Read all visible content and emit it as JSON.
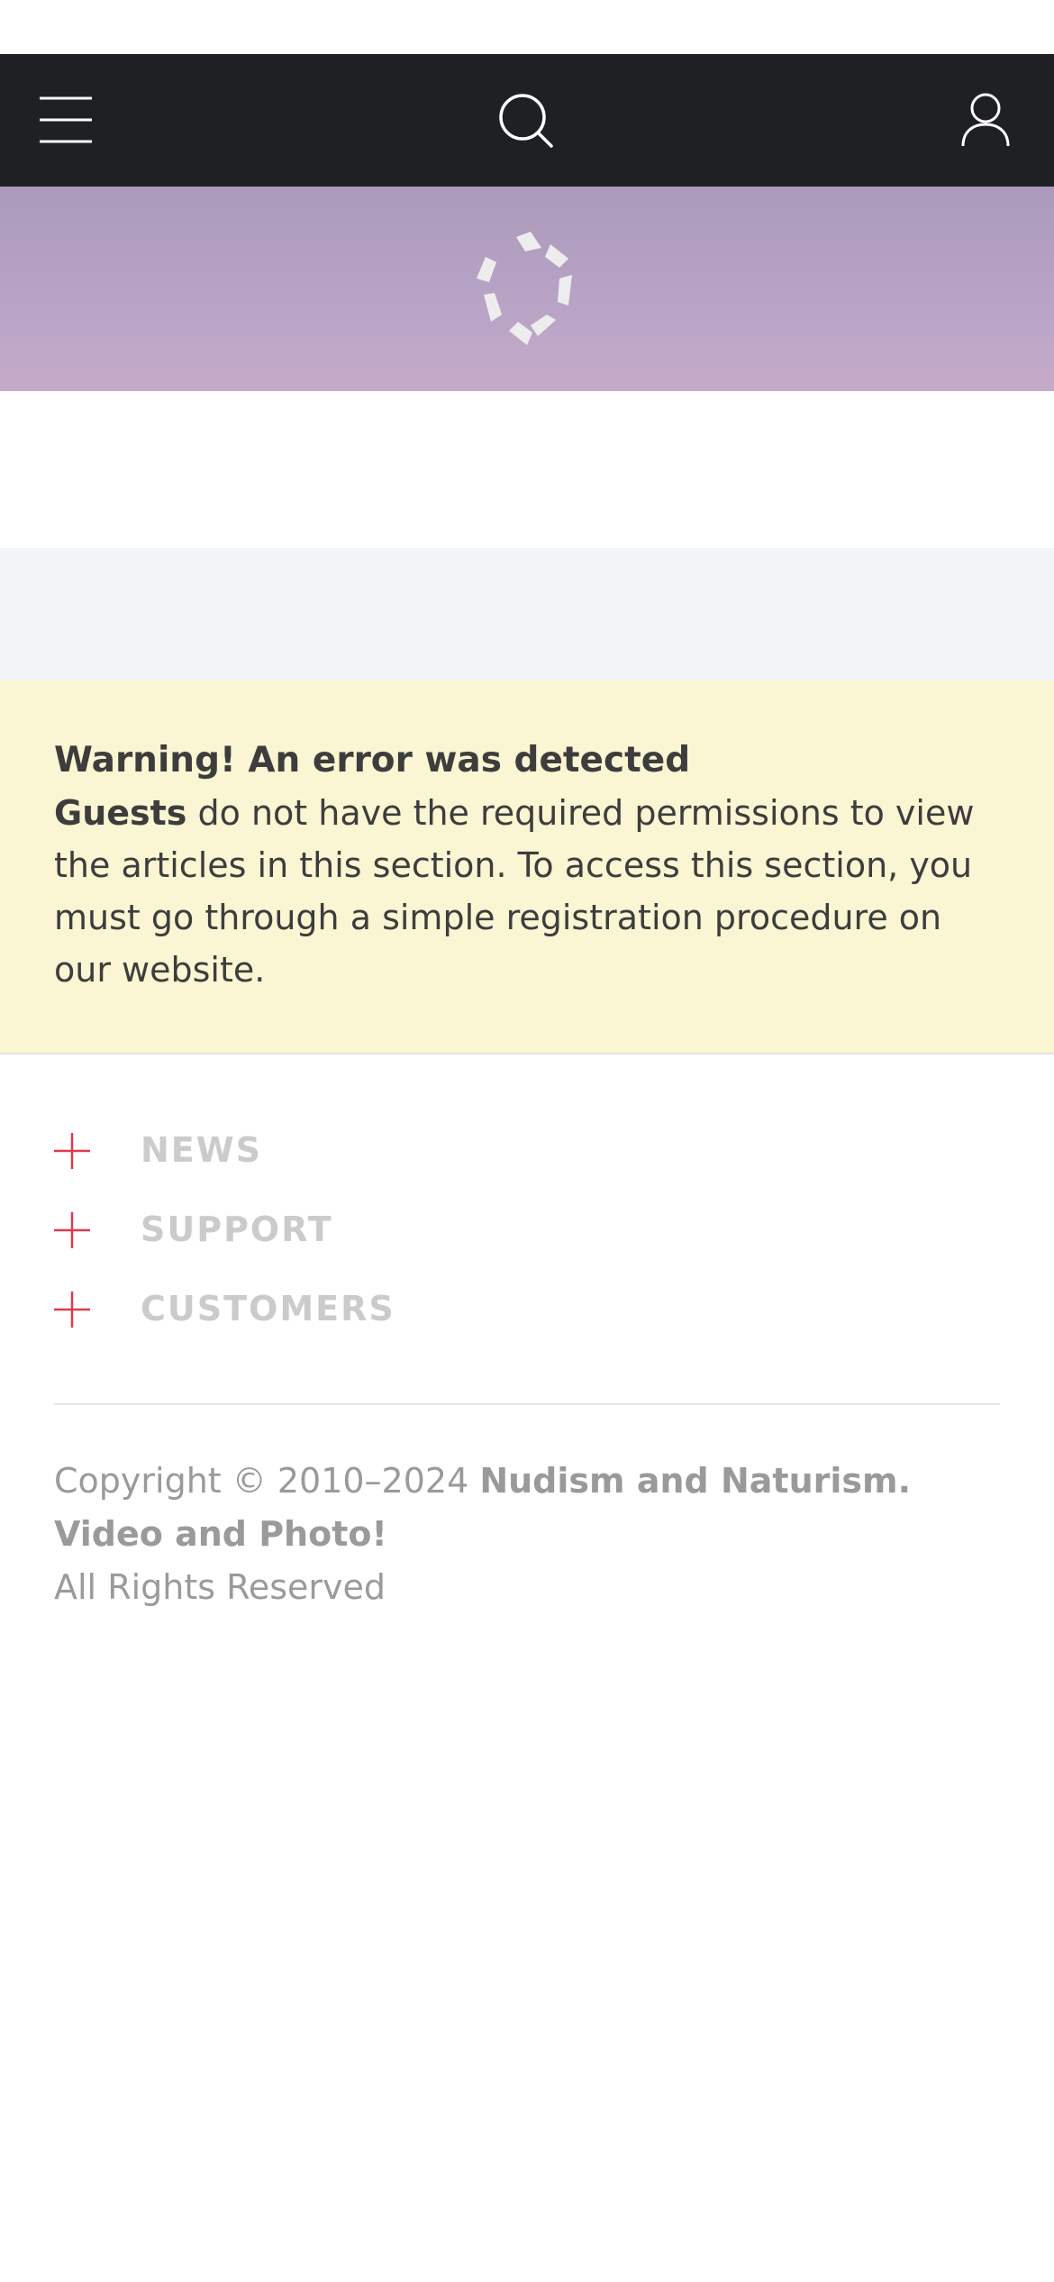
{
  "header": {
    "menu_icon": "hamburger-icon",
    "search_icon": "search-icon",
    "user_icon": "user-icon",
    "background": "#1e2023"
  },
  "banner": {
    "logo_icon": "star-logo-icon"
  },
  "alert": {
    "title": "Warning! An error was detected",
    "guests_label": "Guests",
    "message": " do not have the required permissions to view the articles in this section. To access this section, you must go through a simple registration procedure on our website.",
    "background": "#faf5d2"
  },
  "menu": {
    "items": [
      {
        "label": "NEWS",
        "icon": "plus-icon"
      },
      {
        "label": "SUPPORT",
        "icon": "plus-icon"
      },
      {
        "label": "CUSTOMERS",
        "icon": "plus-icon"
      }
    ],
    "accent": "#e0394f"
  },
  "footer": {
    "copyright_prefix": "Copyright © 2010–2024 ",
    "site_name": "Nudism and Naturism. Video and Photo!",
    "rights": "All Rights Reserved"
  }
}
